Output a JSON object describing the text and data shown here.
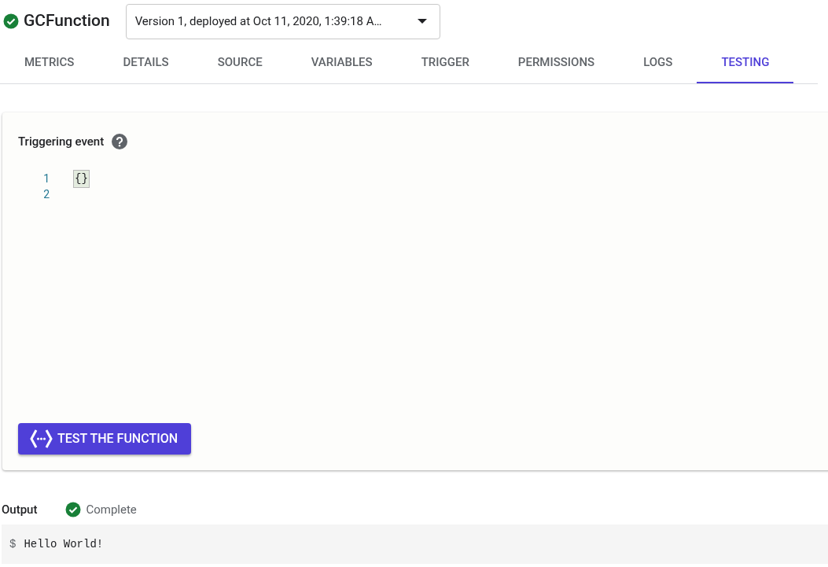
{
  "header": {
    "title": "GCFunction",
    "healthy": true,
    "version_select": {
      "value": "Version 1, deployed at Oct 11, 2020, 1:39:18 A…"
    }
  },
  "tabs": [
    {
      "label": "METRICS",
      "selected": false
    },
    {
      "label": "DETAILS",
      "selected": false
    },
    {
      "label": "SOURCE",
      "selected": false
    },
    {
      "label": "VARIABLES",
      "selected": false
    },
    {
      "label": "TRIGGER",
      "selected": false
    },
    {
      "label": "PERMISSIONS",
      "selected": false
    },
    {
      "label": "LOGS",
      "selected": false
    },
    {
      "label": "TESTING",
      "selected": true
    }
  ],
  "event_panel": {
    "label": "Triggering event",
    "editor": {
      "lines": [
        {
          "number": "1",
          "code": "{}"
        },
        {
          "number": "2"
        }
      ]
    },
    "button": "TEST THE FUNCTION"
  },
  "output": {
    "label": "Output",
    "status": {
      "label": "Complete",
      "complete": true
    },
    "prompt": "$",
    "text": "Hello World!"
  }
}
